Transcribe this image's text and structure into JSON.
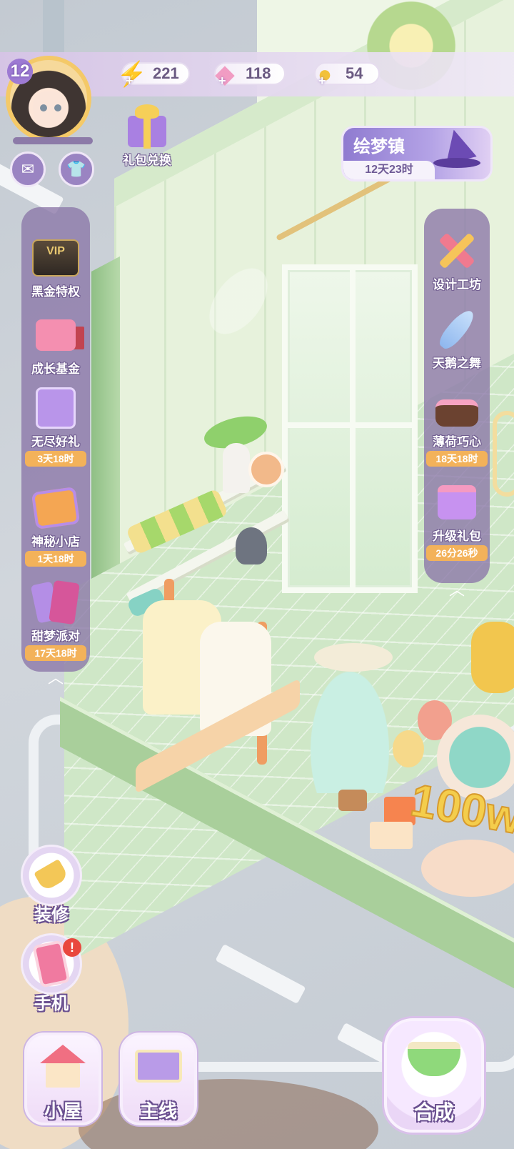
{
  "player": {
    "level": "12"
  },
  "resources": {
    "energy": {
      "value": "221",
      "icon": "lightning-icon"
    },
    "diamonds": {
      "value": "118",
      "icon": "diamond-icon"
    },
    "coins": {
      "value": "54",
      "icon": "coin-icon"
    }
  },
  "top_buttons": {
    "mail_icon": "mail-icon",
    "wardrobe_icon": "shirt-icon"
  },
  "gift_exchange": {
    "label": "礼包兑换"
  },
  "event": {
    "title": "绘梦镇",
    "timer": "12天23时"
  },
  "left_rail": {
    "items": [
      {
        "label": "黑金特权",
        "icon": "vip-card-icon",
        "timer": ""
      },
      {
        "label": "成长基金",
        "icon": "gift-box-icon",
        "timer": ""
      },
      {
        "label": "无尽好礼",
        "icon": "cat-gift-icon",
        "timer": "3天18时"
      },
      {
        "label": "神秘小店",
        "icon": "mystery-shop-icon",
        "timer": "1天18时"
      },
      {
        "label": "甜梦派对",
        "icon": "party-cards-icon",
        "timer": "17天18时"
      }
    ]
  },
  "right_rail": {
    "items": [
      {
        "label": "设计工坊",
        "icon": "ruler-pencil-icon",
        "timer": ""
      },
      {
        "label": "天鹅之舞",
        "icon": "feather-icon",
        "timer": ""
      },
      {
        "label": "薄荷巧心",
        "icon": "cake-icon",
        "timer": "18天18时"
      },
      {
        "label": "升级礼包",
        "icon": "gift-box-icon",
        "timer": "26分26秒"
      }
    ]
  },
  "side_buttons": {
    "decorate": "装修",
    "phone": "手机",
    "phone_alert": "!"
  },
  "bottom_nav": {
    "house": "小屋",
    "story": "主线",
    "merge": "合成"
  },
  "scene": {
    "sign_text": "100w"
  },
  "colors": {
    "hud_purple": "#8a76a8",
    "timer_orange": "#f3b25a",
    "accent_gold": "#f4c968"
  }
}
